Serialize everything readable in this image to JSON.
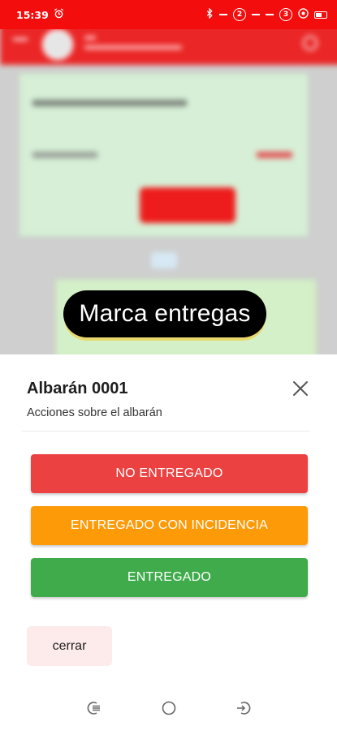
{
  "status_bar": {
    "time": "15:39",
    "sim1": "2",
    "sim2": "3"
  },
  "toast": {
    "text": "Marca entregas"
  },
  "sheet": {
    "title": "Albarán 0001",
    "subtitle": "Acciones sobre el albarán",
    "buttons": {
      "not_delivered": "NO ENTREGADO",
      "delivered_with_incident": "ENTREGADO CON INCIDENCIA",
      "delivered": "ENTREGADO"
    },
    "close_label": "cerrar"
  },
  "colors": {
    "status_bar": "#f40d0d",
    "not_delivered": "#eb4141",
    "delivered_with_incident": "#fc9a07",
    "delivered": "#3fab4b",
    "close_bg": "#fdeaea"
  },
  "icons": {
    "status_left": [
      "alarm-icon"
    ],
    "status_right": [
      "bluetooth-icon",
      "sim-2-icon",
      "sim-3-icon",
      "wifi-icon",
      "battery-icon"
    ],
    "sheet": [
      "close-icon"
    ],
    "nav": [
      "recent-apps-icon",
      "home-icon",
      "back-icon"
    ]
  }
}
